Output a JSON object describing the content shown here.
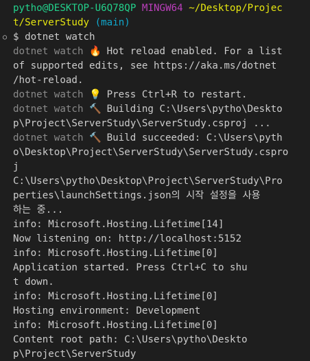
{
  "prompt": {
    "user_host": "pytho@DESKTOP-U6Q78QP",
    "shell": "MINGW64",
    "path_line1": "~/Desktop/Projec",
    "path_line2": "t/ServerStudy",
    "branch": "(main)",
    "gutter_marker": "○",
    "symbol": "$",
    "command": "dotnet watch"
  },
  "icons": {
    "fire": "🔥",
    "bulb": "💡",
    "hammer": "🔨"
  },
  "output": {
    "watch_prefix": "dotnet watch",
    "hot_reload_1": " Hot reload enabled. For a list",
    "hot_reload_2": " of supported edits, see https://aka.ms/dotnet",
    "hot_reload_3": "/hot-reload.",
    "restart": " Press Ctrl+R to restart.",
    "building_1": " Building C:\\Users\\pytho\\Deskto",
    "building_2": "p\\Project\\ServerStudy\\ServerStudy.csproj ...",
    "build_ok_1": " Build succeeded: C:\\Users\\pyth",
    "build_ok_2": "o\\Desktop\\Project\\ServerStudy\\ServerStudy.cspro",
    "build_ok_3": "j",
    "launch_1": "C:\\Users\\pytho\\Desktop\\Project\\ServerStudy\\Pro",
    "launch_2": "perties\\launchSettings.json의 시작 설정을 사용",
    "launch_3": "하는 중...",
    "info_1": "info: Microsoft.Hosting.Lifetime[14]",
    "info_1_msg": "      Now listening on: http://localhost:5152",
    "info_2": "info: Microsoft.Hosting.Lifetime[0]",
    "info_2_msg_1": "      Application started. Press Ctrl+C to shu",
    "info_2_msg_2": "t down.",
    "info_3": "info: Microsoft.Hosting.Lifetime[0]",
    "info_3_msg": "      Hosting environment: Development",
    "info_4": "info: Microsoft.Hosting.Lifetime[0]",
    "info_4_msg_1": "      Content root path: C:\\Users\\pytho\\Deskto",
    "info_4_msg_2": "p\\Project\\ServerStudy"
  }
}
